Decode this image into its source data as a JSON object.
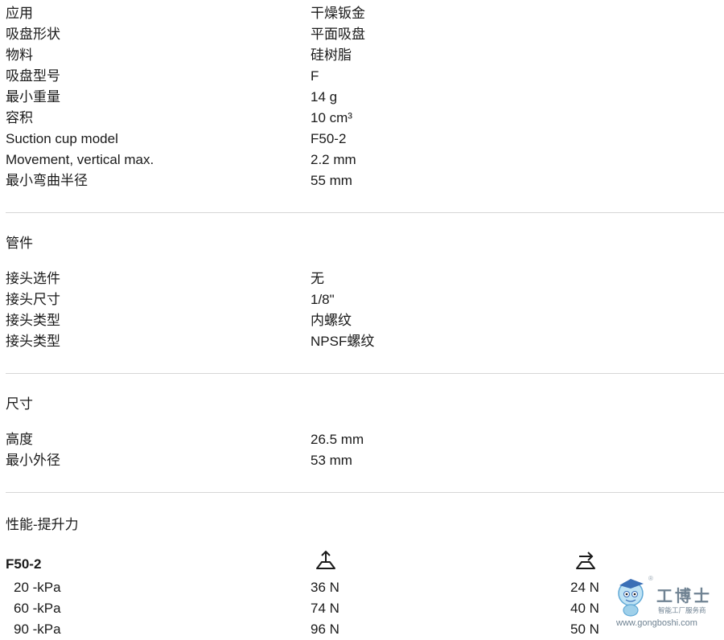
{
  "specs": [
    {
      "label": "应用",
      "value": "干燥钣金"
    },
    {
      "label": "吸盘形状",
      "value": "平面吸盘"
    },
    {
      "label": "物料",
      "value": "硅树脂"
    },
    {
      "label": "吸盘型号",
      "value": "F"
    },
    {
      "label": "最小重量",
      "value": "14 g"
    },
    {
      "label": "容积",
      "value": "10 cm³"
    },
    {
      "label": "Suction cup model",
      "value": "F50-2"
    },
    {
      "label": "Movement, vertical max.",
      "value": "2.2 mm"
    },
    {
      "label": "最小弯曲半径",
      "value": "55 mm"
    }
  ],
  "fittings": {
    "title": "管件",
    "rows": [
      {
        "label": "接头选件",
        "value": "无"
      },
      {
        "label": "接头尺寸",
        "value": "1/8\""
      },
      {
        "label": "接头类型",
        "value": "内螺纹"
      },
      {
        "label": "接头类型",
        "value": "NPSF螺纹"
      }
    ]
  },
  "dimensions": {
    "title": "尺寸",
    "rows": [
      {
        "label": "高度",
        "value": "26.5 mm"
      },
      {
        "label": "最小外径",
        "value": "53 mm"
      }
    ]
  },
  "performance": {
    "title": "性能-提升力",
    "model": "F50-2",
    "icons": [
      "vertical-lift-force-icon",
      "horizontal-lift-force-icon"
    ],
    "rows": [
      {
        "vacuum": "20 -kPa",
        "vertical": "36 N",
        "horizontal": "24 N"
      },
      {
        "vacuum": "60 -kPa",
        "vertical": "74 N",
        "horizontal": "40 N"
      },
      {
        "vacuum": "90 -kPa",
        "vertical": "96 N",
        "horizontal": "50 N"
      }
    ]
  },
  "watermark": {
    "brand": "工博士",
    "tagline": "智能工厂服务商",
    "site": "www.gongboshi.com",
    "reg": "®"
  }
}
